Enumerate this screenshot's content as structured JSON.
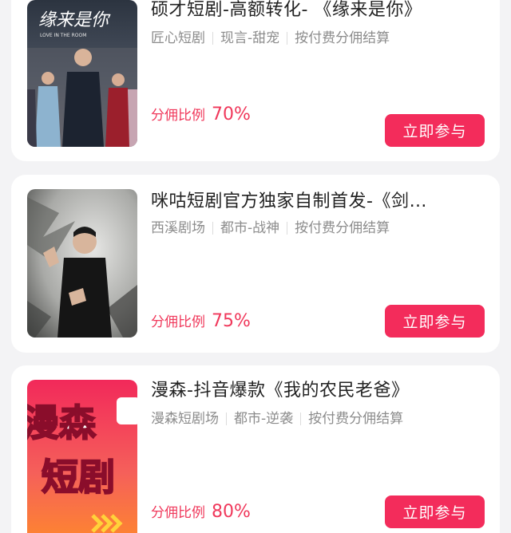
{
  "cards": [
    {
      "title": "硕才短剧-高额转化- 《缘来是你》",
      "tags": [
        "匠心短剧",
        "现言-甜宠",
        "按付费分佣结算"
      ],
      "ratio_label": "分佣比例",
      "ratio_value": "70%",
      "button": "立即参与",
      "poster_title": "缘来是你",
      "poster_subtitle": "LOVE IN THE ROOM"
    },
    {
      "title": "咪咕短剧官方独家自制首发-《剑…",
      "tags": [
        "西溪剧场",
        "都市-战神",
        "按付费分佣结算"
      ],
      "ratio_label": "分佣比例",
      "ratio_value": "75%",
      "button": "立即参与"
    },
    {
      "title": "漫森-抖音爆款《我的农民老爸》",
      "tags": [
        "漫森短剧场",
        "都市-逆袭",
        "按付费分佣结算"
      ],
      "ratio_label": "分佣比例",
      "ratio_value": "80%",
      "button": "立即参与",
      "poster_line1": "漫森",
      "poster_line2": "短剧"
    }
  ],
  "colors": {
    "accent": "#f32c5b",
    "ratio_text": "#f0385b",
    "page_bg": "#f3f3f5"
  }
}
